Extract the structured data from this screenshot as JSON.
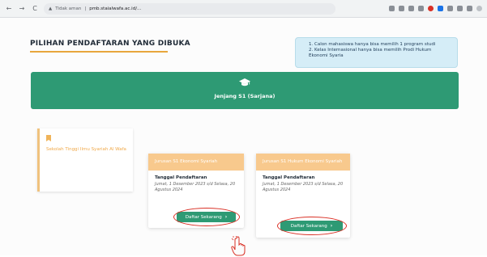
{
  "browser": {
    "back": "←",
    "forward": "→",
    "reload": "C",
    "security_label": "Tidak aman",
    "url": "pmb.staialwafa.ac.id/..."
  },
  "page": {
    "title": "PILIHAN PENDAFTARAN YANG DIBUKA",
    "notices": [
      "1. Calon mahasiswa hanya bisa memilih 1 program studi",
      "2. Kelas Internasional hanya bisa memilih Prodi Hukum Ekonomi Syaria"
    ],
    "level": "Jenjang S1 (Sarjana)"
  },
  "institution": {
    "name": "Sekolah Tinggi Ilmu Syariah Al Wafa"
  },
  "programs": [
    {
      "name": "Jurusan S1 Ekonomi Syariah",
      "reg_label": "Tanggal Pendaftaran",
      "dates": "Jumat, 1 Desember 2023 s/d Selasa, 20 Agustus 2024",
      "button": "Daftar Sekarang",
      "chevron": "›"
    },
    {
      "name": "Jurusan S1 Hukum Ekonomi Syariah",
      "reg_label": "Tanggal Pendaftaran",
      "dates": "Jumat, 1 Desember 2023 s/d Selasa, 20 Agustus 2024",
      "button": "Daftar Sekarang",
      "chevron": "›"
    }
  ],
  "colors": {
    "primary": "#2e9a74",
    "accent": "#f8c98d",
    "highlight": "#d93025"
  }
}
